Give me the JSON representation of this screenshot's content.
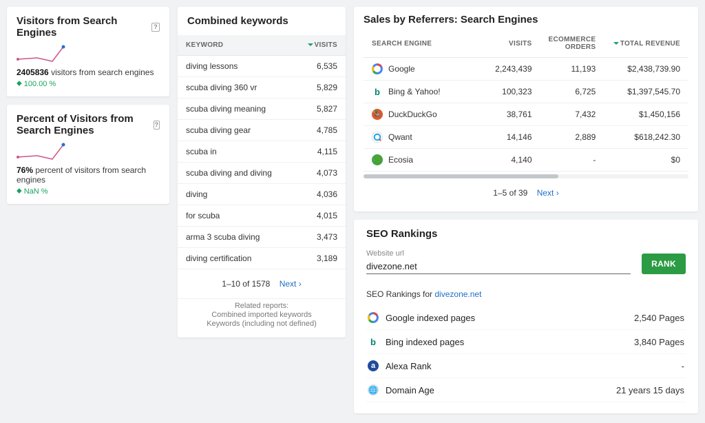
{
  "visitors": {
    "title": "Visitors from Search Engines",
    "statValue": "2405836",
    "statLabel": "visitors from search engines",
    "change": "100.00 %"
  },
  "percent": {
    "title": "Percent of Visitors from Search Engines",
    "statValue": "76%",
    "statLabel": "percent of visitors from search engines",
    "change": "NaN %"
  },
  "keywords": {
    "title": "Combined keywords",
    "colKeyword": "Keyword",
    "colVisits": "Visits",
    "rows": [
      {
        "k": "diving lessons",
        "v": "6,535"
      },
      {
        "k": "scuba diving 360 vr",
        "v": "5,829"
      },
      {
        "k": "scuba diving meaning",
        "v": "5,827"
      },
      {
        "k": "scuba diving gear",
        "v": "4,785"
      },
      {
        "k": "scuba in",
        "v": "4,115"
      },
      {
        "k": "scuba diving and diving",
        "v": "4,073"
      },
      {
        "k": "diving",
        "v": "4,036"
      },
      {
        "k": "for scuba",
        "v": "4,015"
      },
      {
        "k": "arma 3 scuba diving",
        "v": "3,473"
      },
      {
        "k": "diving certification",
        "v": "3,189"
      }
    ],
    "pager": "1–10 of 1578",
    "next": "Next ›",
    "relatedTitle": "Related reports:",
    "related1": "Combined imported keywords",
    "related2": "Keywords (including not defined)"
  },
  "referrers": {
    "title": "Sales by Referrers: Search Engines",
    "colEngine": "Search Engine",
    "colVisits": "Visits",
    "colOrders": "Ecommerce Orders",
    "colRevenue": "Total Revenue",
    "rows": [
      {
        "name": "Google",
        "visits": "2,243,439",
        "orders": "11,193",
        "revenue": "$2,438,739.90",
        "icon": "google"
      },
      {
        "name": "Bing & Yahoo!",
        "visits": "100,323",
        "orders": "6,725",
        "revenue": "$1,397,545.70",
        "icon": "bing"
      },
      {
        "name": "DuckDuckGo",
        "visits": "38,761",
        "orders": "7,432",
        "revenue": "$1,450,156",
        "icon": "ddg"
      },
      {
        "name": "Qwant",
        "visits": "14,146",
        "orders": "2,889",
        "revenue": "$618,242.30",
        "icon": "qwant"
      },
      {
        "name": "Ecosia",
        "visits": "4,140",
        "orders": "-",
        "revenue": "$0",
        "icon": "ecosia"
      }
    ],
    "pager": "1–5 of 39",
    "next": "Next ›"
  },
  "seo": {
    "title": "SEO Rankings",
    "urlLabel": "Website url",
    "urlValue": "divezone.net",
    "rankBtn": "RANK",
    "subLabel": "SEO Rankings for ",
    "subLink": "divezone.net",
    "rows": [
      {
        "label": "Google indexed pages",
        "value": "2,540 Pages",
        "icon": "google"
      },
      {
        "label": "Bing indexed pages",
        "value": "3,840 Pages",
        "icon": "bing"
      },
      {
        "label": "Alexa Rank",
        "value": "-",
        "icon": "alexa"
      },
      {
        "label": "Domain Age",
        "value": "21 years 15 days",
        "icon": "globe"
      }
    ]
  }
}
